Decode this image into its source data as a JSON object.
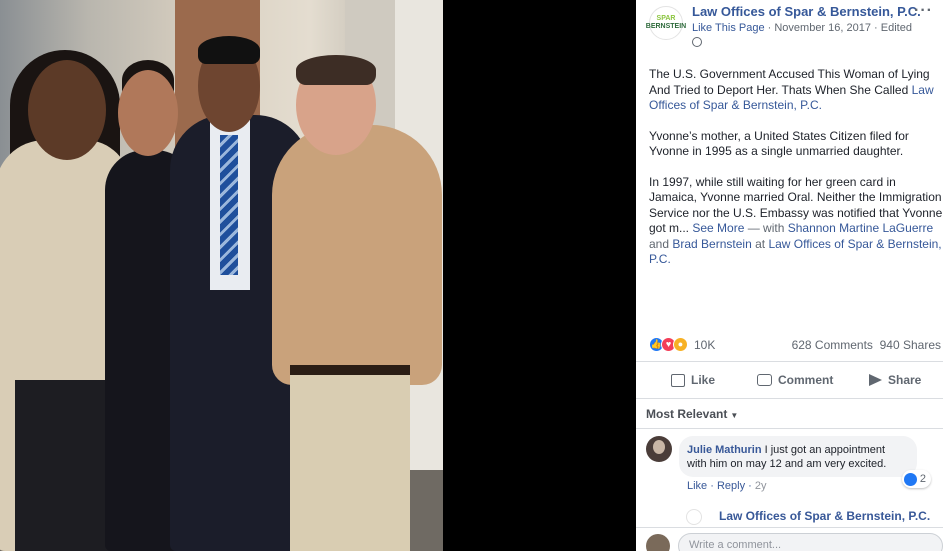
{
  "page": {
    "name": "Law Offices of Spar & Bernstein, P.C.",
    "like_page": "Like This Page",
    "date": "November 16, 2017",
    "edited": "Edited",
    "meta_sep": " · ",
    "more": "···",
    "logo_top": "SPAR",
    "logo_bottom": "BERNSTEIN"
  },
  "post": {
    "p1": "The U.S. Government Accused This Woman of Lying And Tried to Deport Her. Thats When She Called ",
    "p1_link": "Law Offices of Spar & Bernstein, P.C.",
    "p2": "Yvonne’s mother, a United States Citizen filed for Yvonne in 1995 as a single unmarried daughter.",
    "p3": "In 1997, while still waiting for her green card in Jamaica, Yvonne married Oral. Neither the Immigration Service nor the U.S. Embassy was notified that Yvonne got m...",
    "see_more": "See More",
    "with": " — with ",
    "tag1": "Shannon Martine LaGuerre",
    "and": " and ",
    "tag2": "Brad Bernstein",
    "at": " at ",
    "tag3": "Law Offices of Spar & Bernstein, P.C."
  },
  "stats": {
    "reactions": "10K",
    "comments": "628 Comments",
    "shares": "940 Shares"
  },
  "actions": {
    "like": "Like",
    "comment": "Comment",
    "share": "Share"
  },
  "comments_filter": "Most Relevant",
  "comment": {
    "author": "Julie Mathurin",
    "text": " I just got an appointment with him on may 12 and am very excited.",
    "reaction_count": "2",
    "like": "Like",
    "reply": "Reply",
    "time": "2y"
  },
  "reply": {
    "author": "Law Offices of Spar & Bernstein, P.C."
  },
  "composer": {
    "placeholder": "Write a comment..."
  },
  "colors": {
    "link": "#365899",
    "like_blue": "#2078f4",
    "love_red": "#f33e58",
    "wow_yellow": "#f7b125"
  },
  "icons": [
    "globe-icon",
    "like-reaction-icon",
    "love-reaction-icon",
    "wow-reaction-icon",
    "thumbs-up-icon",
    "comment-icon",
    "share-icon",
    "emoji-icon",
    "camera-icon",
    "gif-icon",
    "sticker-icon"
  ]
}
